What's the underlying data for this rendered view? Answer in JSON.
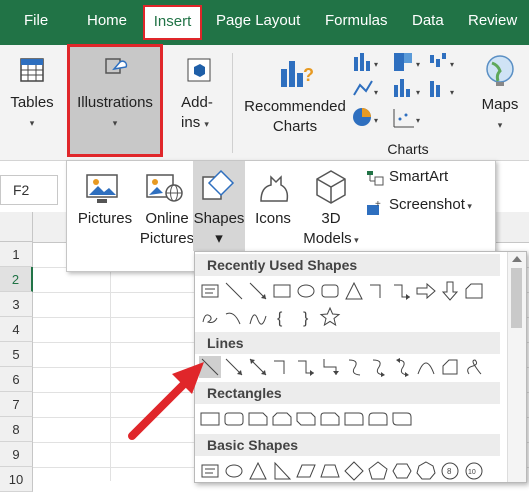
{
  "tabs": [
    "File",
    "Home",
    "Insert",
    "Page Layout",
    "Formulas",
    "Data",
    "Review"
  ],
  "ribbon": {
    "tables": "Tables",
    "illustrations": "Illustrations",
    "addins_1": "Add-",
    "addins_2": "ins",
    "recommended_1": "Recommended",
    "recommended_2": "Charts",
    "charts": "Charts",
    "maps": "Maps"
  },
  "namebox": "F2",
  "rows": [
    "1",
    "2",
    "3",
    "4",
    "5",
    "6",
    "7",
    "8",
    "9",
    "10"
  ],
  "illustrations_menu": {
    "pictures": "Pictures",
    "online_1": "Online",
    "online_2": "Pictures",
    "shapes": "Shapes",
    "icons": "Icons",
    "models_1": "3D",
    "models_2": "Models",
    "smartart": "SmartArt",
    "screenshot": "Screenshot"
  },
  "shapes_panel": {
    "recent": "Recently Used Shapes",
    "lines": "Lines",
    "rectangles": "Rectangles",
    "basic": "Basic Shapes"
  },
  "colors": {
    "accent": "#217346",
    "highlight": "#e0262a"
  }
}
